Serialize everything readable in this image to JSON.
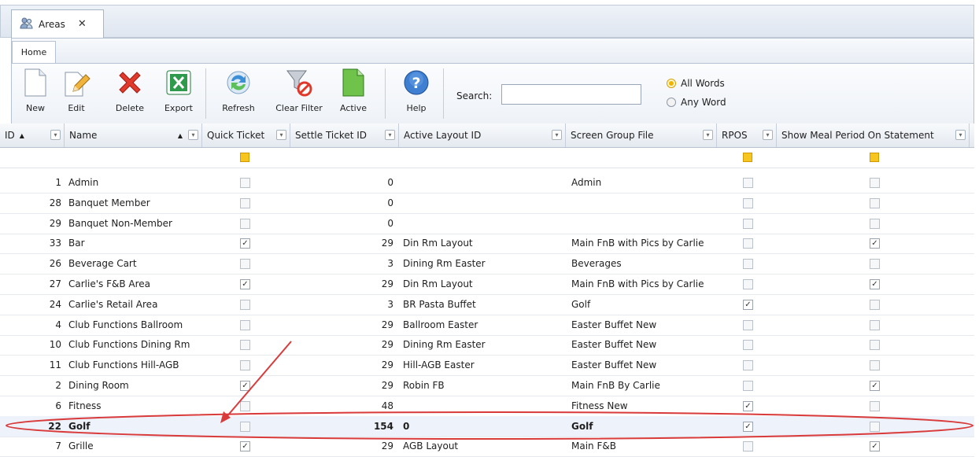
{
  "doc_tab": {
    "title": "Areas",
    "close_glyph": "✕"
  },
  "ribbon": {
    "tab": "Home",
    "buttons": [
      {
        "name": "new",
        "label": "New"
      },
      {
        "name": "edit",
        "label": "Edit"
      },
      {
        "name": "delete",
        "label": "Delete"
      },
      {
        "name": "export",
        "label": "Export"
      },
      {
        "name": "refresh",
        "label": "Refresh"
      },
      {
        "name": "clear-filter",
        "label": "Clear Filter"
      },
      {
        "name": "active",
        "label": "Active"
      },
      {
        "name": "help",
        "label": "Help"
      }
    ],
    "search_label": "Search:",
    "search_value": "",
    "option_all": "All Words",
    "option_any": "Any Word",
    "selected_option": "All Words"
  },
  "colors": {
    "accent": "#f7c520",
    "header_bg": "#e4e9f0",
    "annotation": "#d93a3a"
  },
  "grid": {
    "columns": [
      "ID",
      "Name",
      "Quick Ticket",
      "Settle Ticket ID",
      "Active Layout ID",
      "Screen Group File",
      "RPOS",
      "Show Meal Period On Statement"
    ],
    "sort_ascending_glyph": "▲",
    "filter_glyph": "▾",
    "check_glyph": "✓",
    "rows": [
      {
        "id": "1",
        "name": "Admin",
        "quick": false,
        "settle": "0",
        "layout": "",
        "screen": "Admin",
        "rpos": false,
        "meal": false
      },
      {
        "id": "28",
        "name": "Banquet Member",
        "quick": false,
        "settle": "0",
        "layout": "",
        "screen": "",
        "rpos": false,
        "meal": false
      },
      {
        "id": "29",
        "name": "Banquet Non-Member",
        "quick": false,
        "settle": "0",
        "layout": "",
        "screen": "",
        "rpos": false,
        "meal": false
      },
      {
        "id": "33",
        "name": "Bar",
        "quick": true,
        "settle": "29",
        "layout": "Din Rm Layout",
        "screen": "Main FnB with Pics by Carlie",
        "rpos": false,
        "meal": true
      },
      {
        "id": "26",
        "name": "Beverage Cart",
        "quick": false,
        "settle": "3",
        "layout": "Dining Rm Easter",
        "screen": "Beverages",
        "rpos": false,
        "meal": false
      },
      {
        "id": "27",
        "name": "Carlie's F&B Area",
        "quick": true,
        "settle": "29",
        "layout": "Din Rm Layout",
        "screen": "Main FnB with Pics by Carlie",
        "rpos": false,
        "meal": true
      },
      {
        "id": "24",
        "name": "Carlie's Retail Area",
        "quick": false,
        "settle": "3",
        "layout": "BR Pasta Buffet",
        "screen": "Golf",
        "rpos": true,
        "meal": false
      },
      {
        "id": "4",
        "name": "Club Functions Ballroom",
        "quick": false,
        "settle": "29",
        "layout": "Ballroom Easter",
        "screen": "Easter Buffet New",
        "rpos": false,
        "meal": false
      },
      {
        "id": "10",
        "name": "Club Functions Dining Rm",
        "quick": false,
        "settle": "29",
        "layout": "Dining Rm Easter",
        "screen": "Easter Buffet New",
        "rpos": false,
        "meal": false
      },
      {
        "id": "11",
        "name": "Club Functions Hill-AGB",
        "quick": false,
        "settle": "29",
        "layout": "Hill-AGB Easter",
        "screen": "Easter Buffet New",
        "rpos": false,
        "meal": false
      },
      {
        "id": "2",
        "name": "Dining Room",
        "quick": true,
        "settle": "29",
        "layout": "Robin FB",
        "screen": "Main FnB By Carlie",
        "rpos": false,
        "meal": true
      },
      {
        "id": "6",
        "name": "Fitness",
        "quick": false,
        "settle": "48",
        "layout": "",
        "screen": "Fitness New",
        "rpos": true,
        "meal": false
      },
      {
        "id": "22",
        "name": "Golf",
        "quick": false,
        "settle": "154",
        "layout": "0",
        "screen": "Golf",
        "rpos": true,
        "meal": false,
        "bold": true
      },
      {
        "id": "7",
        "name": "Grille",
        "quick": true,
        "settle": "29",
        "layout": "AGB Layout",
        "screen": "Main F&B",
        "rpos": false,
        "meal": true
      }
    ]
  }
}
